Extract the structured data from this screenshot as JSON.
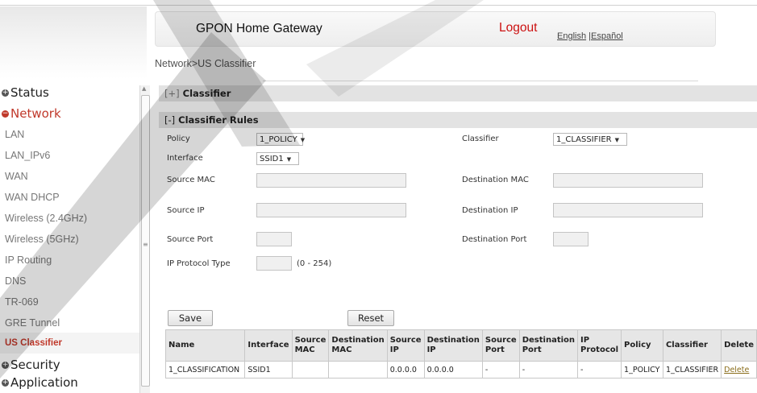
{
  "header": {
    "title": "GPON Home Gateway",
    "logout": "Logout",
    "lang_english": "English",
    "lang_sep": " |",
    "lang_spanish": "Español"
  },
  "breadcrumb": "Network>US Classifier",
  "sidebar": {
    "categories": [
      {
        "label": "Status",
        "state": "collapsed"
      },
      {
        "label": "Network",
        "state": "expanded"
      },
      {
        "label": "Security",
        "state": "collapsed"
      },
      {
        "label": "Application",
        "state": "collapsed"
      }
    ],
    "items": [
      "LAN",
      "LAN_IPv6",
      "WAN",
      "WAN DHCP",
      "Wireless (2.4GHz)",
      "Wireless (5GHz)",
      "IP Routing",
      "DNS",
      "TR-069",
      "GRE Tunnel",
      "US Classifier"
    ],
    "active_item": "US Classifier"
  },
  "sections": {
    "classifier": {
      "toggle": "[+]",
      "title": "Classifier"
    },
    "rules": {
      "toggle": "[-]",
      "title": "Classifier Rules"
    }
  },
  "form": {
    "policy": {
      "label": "Policy",
      "value": "1_POLICY"
    },
    "classifier": {
      "label": "Classifier",
      "value": "1_CLASSIFIER"
    },
    "interface": {
      "label": "Interface",
      "value": "SSID1"
    },
    "source_mac": {
      "label": "Source MAC",
      "value": ""
    },
    "destination_mac": {
      "label": "Destination MAC",
      "value": ""
    },
    "source_ip": {
      "label": "Source IP",
      "value": ""
    },
    "destination_ip": {
      "label": "Destination IP",
      "value": ""
    },
    "source_port": {
      "label": "Source Port",
      "value": ""
    },
    "destination_port": {
      "label": "Destination Port",
      "value": ""
    },
    "ip_protocol_type": {
      "label": "IP Protocol Type",
      "value": "",
      "hint": "(0 - 254)"
    }
  },
  "buttons": {
    "save": "Save",
    "reset": "Reset"
  },
  "table": {
    "headers": [
      "Name",
      "Interface",
      "Source MAC",
      "Destination MAC",
      "Source IP",
      "Destination IP",
      "Source Port",
      "Destination Port",
      "IP Protocol",
      "Policy",
      "Classifier",
      "Delete"
    ],
    "rows": [
      [
        "1_CLASSIFICATION",
        "SSID1",
        "",
        "",
        "0.0.0.0",
        "0.0.0.0",
        "-",
        "-",
        "-",
        "1_POLICY",
        "1_CLASSIFIER",
        "Delete"
      ]
    ]
  },
  "colors": {
    "accent_red": "#cc1111",
    "menu_red": "#c0392b",
    "section_bar": "#e3e3e3"
  }
}
